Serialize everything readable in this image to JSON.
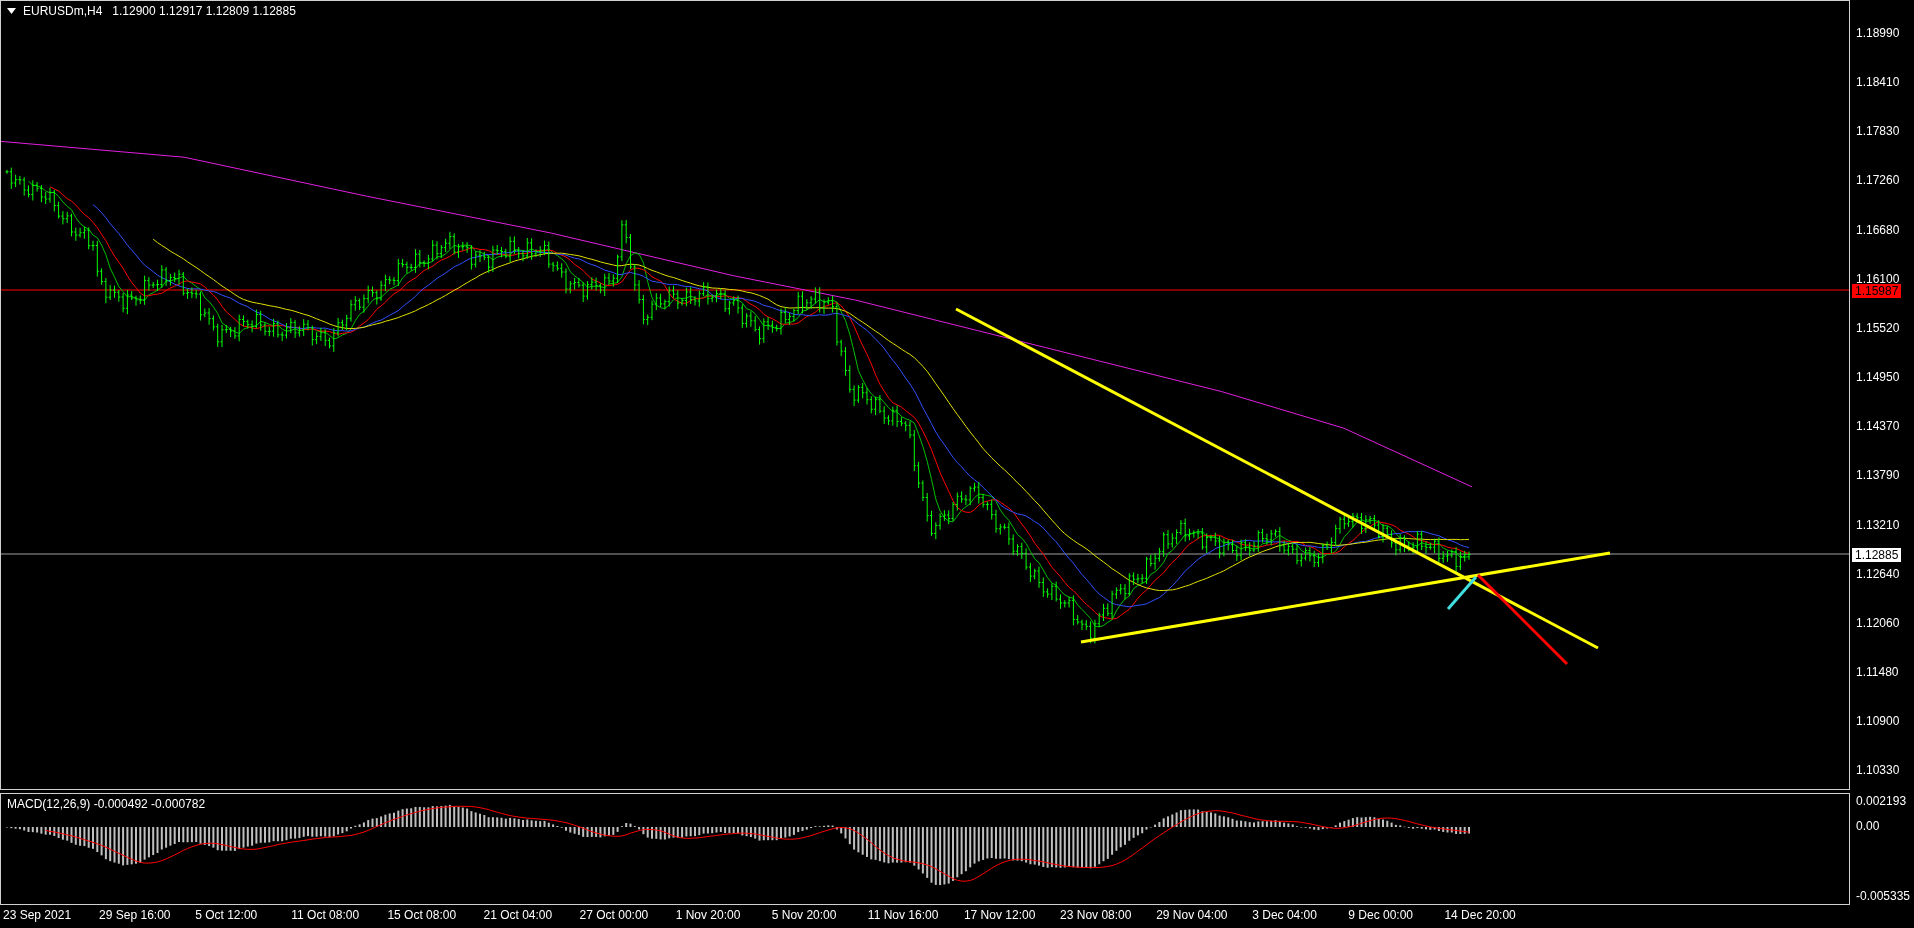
{
  "header": {
    "symbol": "EURUSDm,H4",
    "ohlc": "1.12900 1.12917 1.12809 1.12885"
  },
  "price_axis": {
    "labels": [
      "1.18990",
      "1.18410",
      "1.17830",
      "1.17260",
      "1.16680",
      "1.16100",
      "1.15520",
      "1.14950",
      "1.14370",
      "1.13790",
      "1.13210",
      "1.12640",
      "1.12060",
      "1.11480",
      "1.10900",
      "1.10330"
    ]
  },
  "price_markers": [
    {
      "label": "1.15987",
      "color": "#ff0000"
    },
    {
      "label": "1.12885",
      "color": "#ffffff"
    }
  ],
  "macd": {
    "label": "MACD(12,26,9) -0.000492 -0.000782",
    "axis_labels": [
      "0.002193",
      "0.00",
      "-0.005335"
    ]
  },
  "time_axis": {
    "labels": [
      "23 Sep 2021",
      "29 Sep 16:00",
      "5 Oct 12:00",
      "11 Oct 08:00",
      "15 Oct 08:00",
      "21 Oct 04:00",
      "27 Oct 00:00",
      "1 Nov 20:00",
      "5 Nov 20:00",
      "11 Nov 16:00",
      "17 Nov 12:00",
      "23 Nov 08:00",
      "29 Nov 04:00",
      "3 Dec 04:00",
      "9 Dec 00:00",
      "14 Dec 20:00"
    ]
  }
}
